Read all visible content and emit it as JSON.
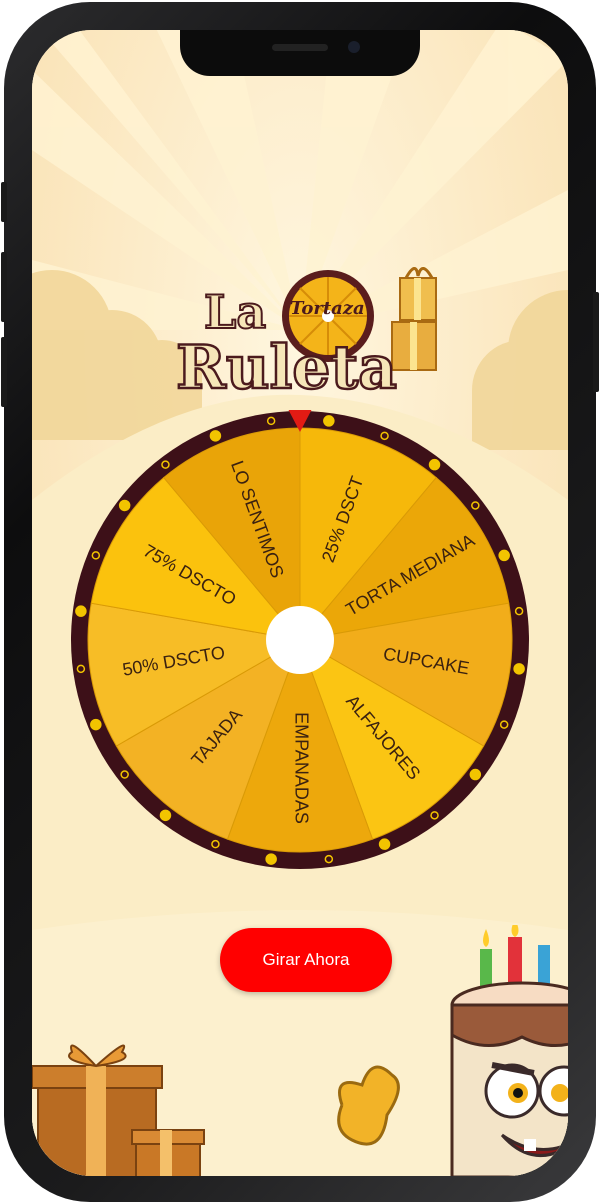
{
  "app": {
    "logo": {
      "line1": "La",
      "brand": "Tortaza",
      "line2": "Ruleta"
    }
  },
  "wheel": {
    "segments": [
      {
        "label": "25% DSCT",
        "color": "#f6b80a"
      },
      {
        "label": "TORTA MEDIANA",
        "color": "#eba708"
      },
      {
        "label": "CUPCAKE",
        "color": "#f2ad1a"
      },
      {
        "label": "ALFAJORES",
        "color": "#fbc513"
      },
      {
        "label": "EMPANADAS",
        "color": "#eda80c"
      },
      {
        "label": "TAJADA",
        "color": "#f3b224"
      },
      {
        "label": "50% DSCTO",
        "color": "#f7bd26"
      },
      {
        "label": "75% DSCTO",
        "color": "#fbc20d"
      },
      {
        "label": "LO SENTIMOS",
        "color": "#e9a408"
      }
    ],
    "rim_color": "#3d1018",
    "dot_color": "#f2c400",
    "pointer_color": "#e31b14"
  },
  "actions": {
    "spin_label": "Girar Ahora"
  }
}
